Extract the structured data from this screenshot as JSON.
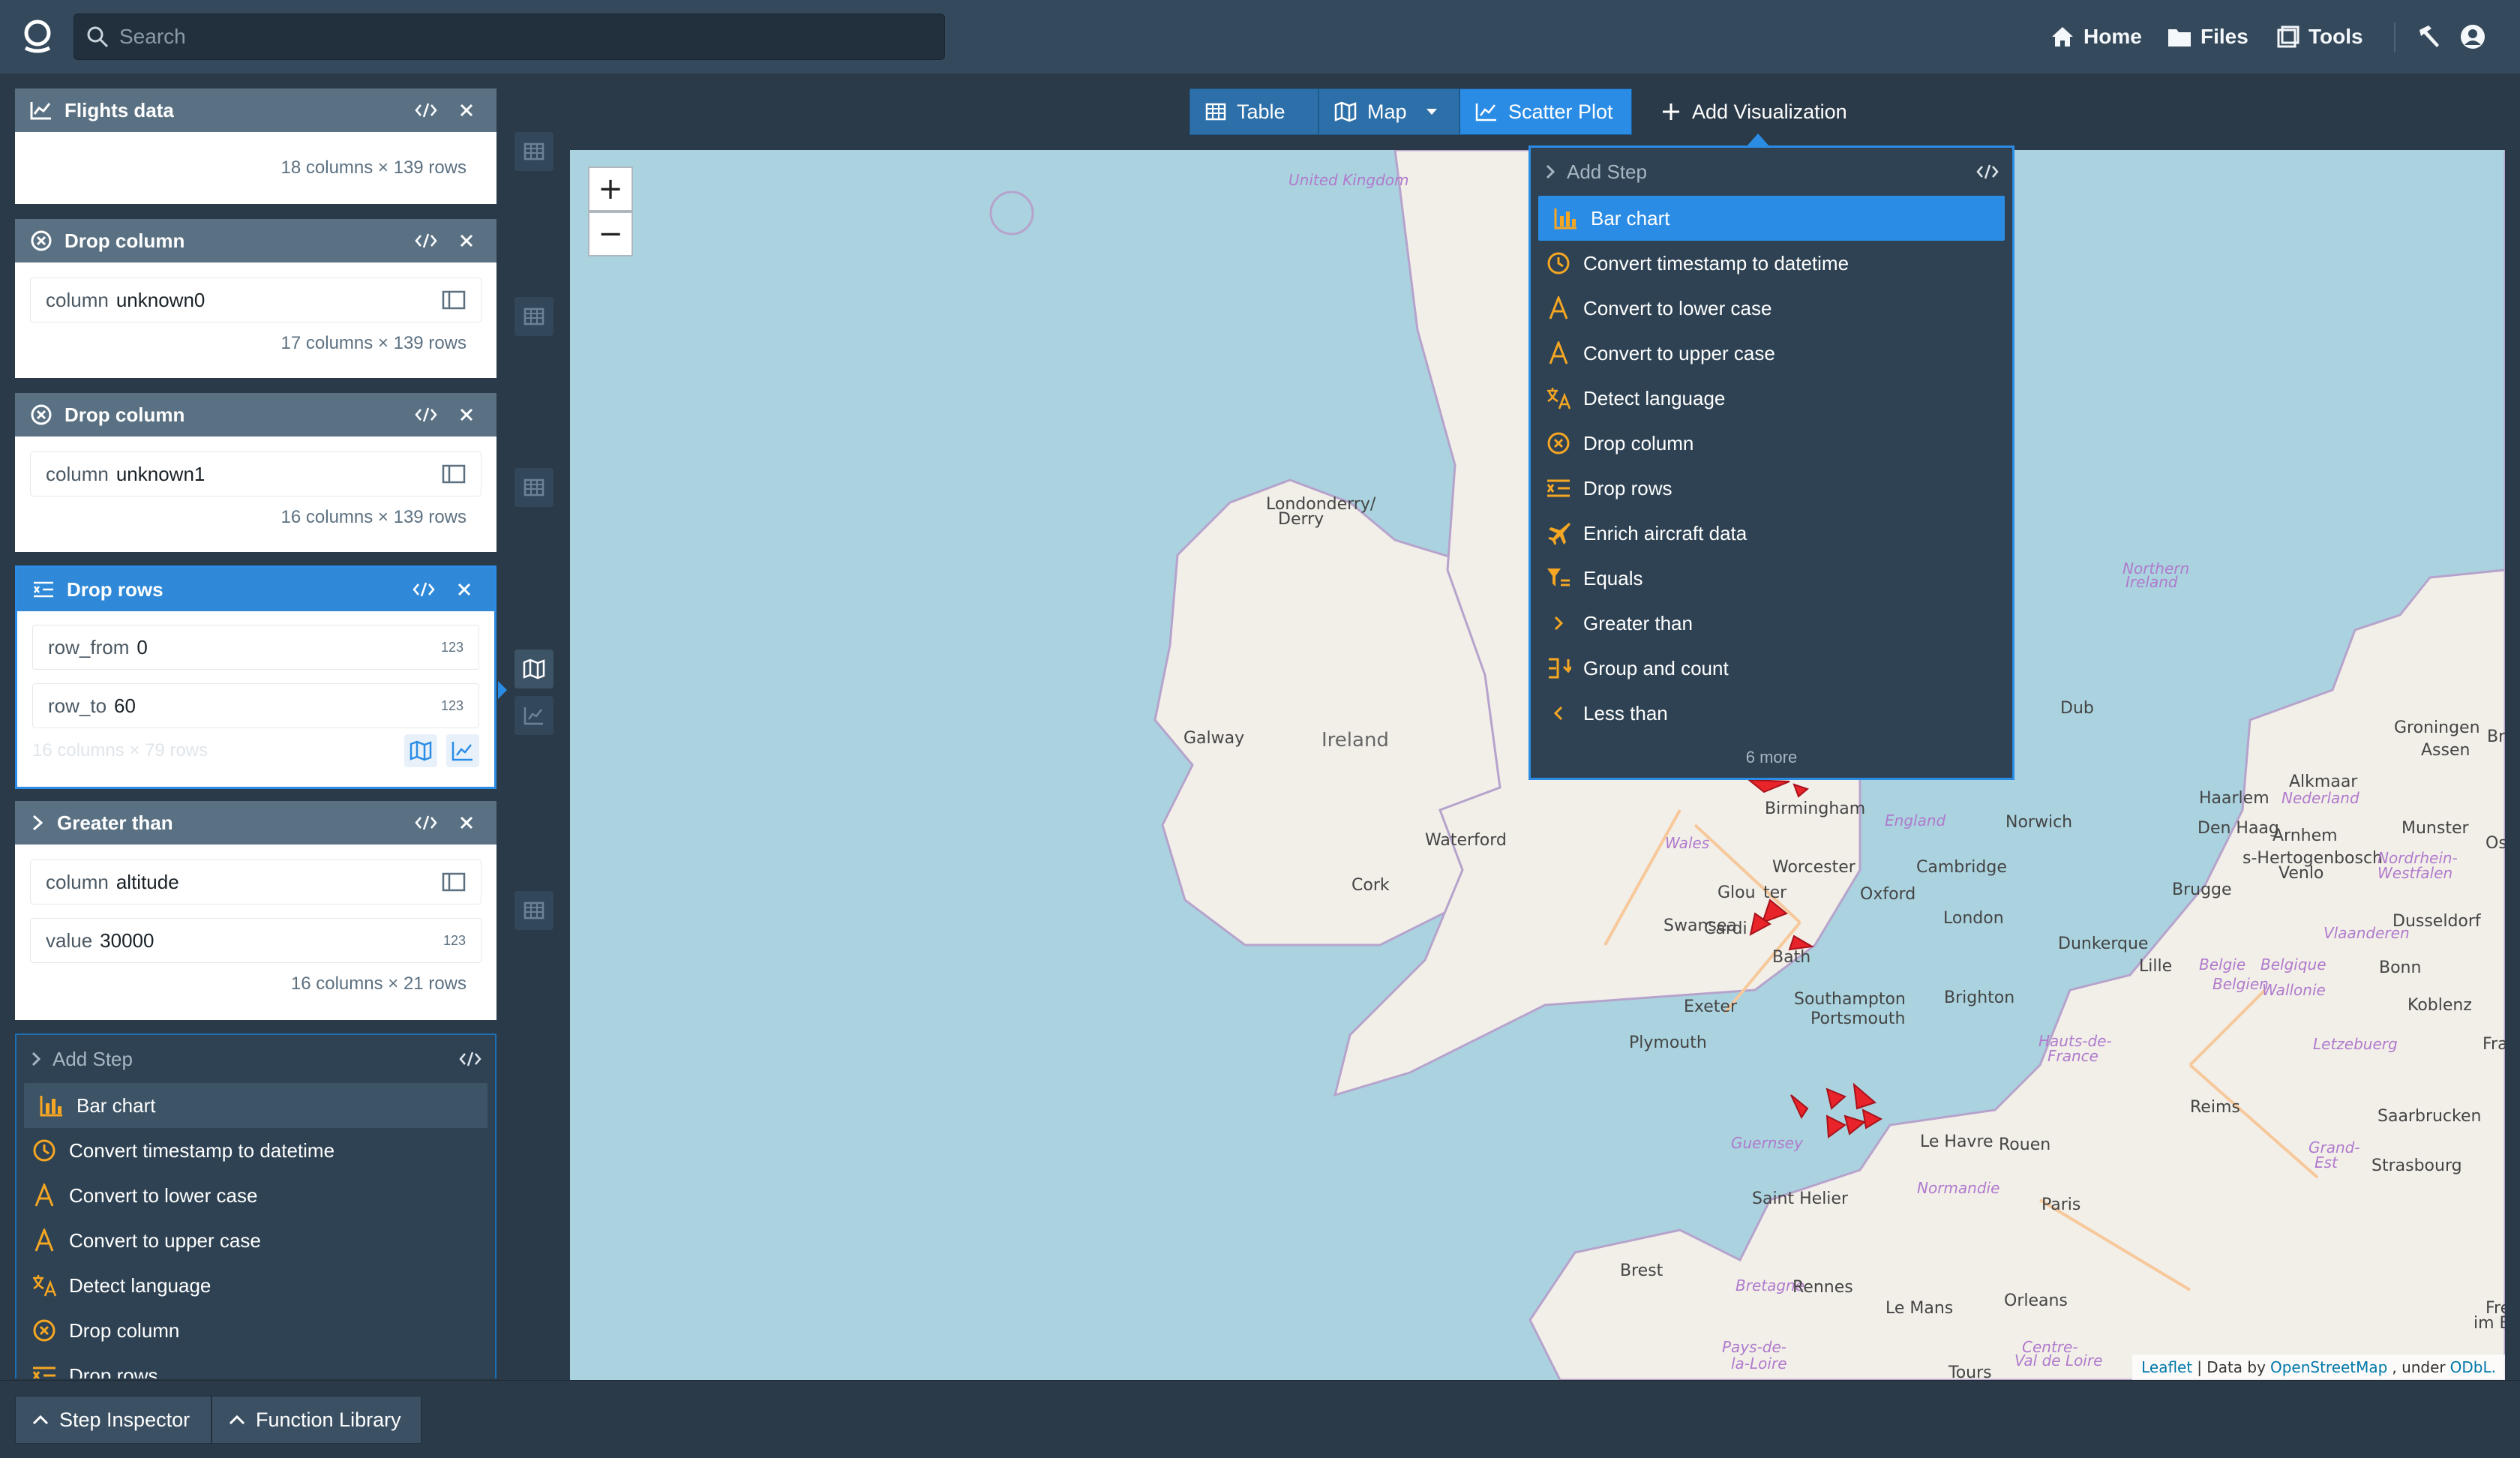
{
  "topbar": {
    "search_placeholder": "Search",
    "nav": [
      {
        "label": "Home",
        "icon": "home-icon"
      },
      {
        "label": "Files",
        "icon": "folder-icon"
      },
      {
        "label": "Tools",
        "icon": "tools-icon"
      }
    ]
  },
  "cards": {
    "flights": {
      "title": "Flights data",
      "rows_info": "18 columns × 139 rows"
    },
    "drop1": {
      "title": "Drop column",
      "param_name": "column",
      "param_value": "unknown0",
      "rows_info": "17 columns × 139 rows"
    },
    "drop2": {
      "title": "Drop column",
      "param_name": "column",
      "param_value": "unknown1",
      "rows_info": "16 columns × 139 rows"
    },
    "droprows": {
      "title": "Drop rows",
      "p1_name": "row_from",
      "p1_value": "0",
      "p1_badge": "123",
      "p2_name": "row_to",
      "p2_value": "60",
      "p2_badge": "123",
      "rows_info": "16 columns × 79 rows"
    },
    "greater": {
      "title": "Greater than",
      "p1_name": "column",
      "p1_value": "altitude",
      "p2_name": "value",
      "p2_value": "30000",
      "p2_badge": "123",
      "rows_info": "16 columns × 21 rows"
    }
  },
  "left_menu": {
    "header": "Add Step",
    "items": [
      {
        "label": "Bar chart",
        "icon": "bar-chart-icon",
        "selected": true
      },
      {
        "label": "Convert timestamp to datetime",
        "icon": "clock-icon"
      },
      {
        "label": "Convert to lower case",
        "icon": "font-a-icon"
      },
      {
        "label": "Convert to upper case",
        "icon": "font-a-icon"
      },
      {
        "label": "Detect language",
        "icon": "translate-icon"
      },
      {
        "label": "Drop column",
        "icon": "circle-x-icon"
      },
      {
        "label": "Drop rows",
        "icon": "drop-rows-icon"
      }
    ]
  },
  "viz_toolbar": {
    "table": "Table",
    "map": "Map",
    "scatter": "Scatter Plot",
    "add": "Add Visualization"
  },
  "viz_menu": {
    "header": "Add Step",
    "items": [
      {
        "label": "Bar chart",
        "icon": "bar-chart-icon",
        "selected": true
      },
      {
        "label": "Convert timestamp to datetime",
        "icon": "clock-icon"
      },
      {
        "label": "Convert to lower case",
        "icon": "font-a-icon"
      },
      {
        "label": "Convert to upper case",
        "icon": "font-a-icon"
      },
      {
        "label": "Detect language",
        "icon": "translate-icon"
      },
      {
        "label": "Drop column",
        "icon": "circle-x-icon"
      },
      {
        "label": "Drop rows",
        "icon": "drop-rows-icon"
      },
      {
        "label": "Enrich aircraft data",
        "icon": "airplane-icon"
      },
      {
        "label": "Equals",
        "icon": "filter-equals-icon"
      },
      {
        "label": "Greater than",
        "icon": "chevron-right-icon"
      },
      {
        "label": "Group and count",
        "icon": "group-count-icon"
      },
      {
        "label": "Less than",
        "icon": "chevron-left-icon"
      }
    ],
    "more": "6 more"
  },
  "map": {
    "zoom_in": "+",
    "zoom_out": "−",
    "labels": [
      {
        "text": "United Kingdom",
        "cls": "big"
      },
      {
        "text": "Londonderry/"
      },
      {
        "text": "Derry"
      },
      {
        "text": "Northern"
      },
      {
        "text": "Ireland"
      },
      {
        "text": "Dub"
      },
      {
        "text": "Galway"
      },
      {
        "text": "Ireland"
      },
      {
        "text": "Waterford"
      },
      {
        "text": "Cork"
      },
      {
        "text": "Birmingham"
      },
      {
        "text": "England"
      },
      {
        "text": "Norwich"
      },
      {
        "text": "Wales"
      },
      {
        "text": "Worcester"
      },
      {
        "text": "Cambridge"
      },
      {
        "text": "Glou"
      },
      {
        "text": "ter"
      },
      {
        "text": "Oxford"
      },
      {
        "text": "Swansea"
      },
      {
        "text": "Cardi"
      },
      {
        "text": "London"
      },
      {
        "text": "Bath"
      },
      {
        "text": "Exeter"
      },
      {
        "text": "Southampton"
      },
      {
        "text": "Brighton"
      },
      {
        "text": "Portsmouth"
      },
      {
        "text": "Plymouth"
      },
      {
        "text": "Guernsey"
      },
      {
        "text": "Le Havre"
      },
      {
        "text": "Rouen"
      },
      {
        "text": "Saint Helier"
      },
      {
        "text": "Normandie"
      },
      {
        "text": "Paris"
      },
      {
        "text": "Brest"
      },
      {
        "text": "Bretagne"
      },
      {
        "text": "Rennes"
      },
      {
        "text": "Le Mans"
      },
      {
        "text": "Orleans"
      },
      {
        "text": "Tours"
      },
      {
        "text": "Pays-de-"
      },
      {
        "text": "la-Loire"
      },
      {
        "text": "Centre-"
      },
      {
        "text": "Val de Loire"
      },
      {
        "text": "Groningen"
      },
      {
        "text": "Assen"
      },
      {
        "text": "Alkmaar"
      },
      {
        "text": "Haarlem"
      },
      {
        "text": "Nederland"
      },
      {
        "text": "Den Haag"
      },
      {
        "text": "Arnhem"
      },
      {
        "text": "Munster"
      },
      {
        "text": "Osnab"
      },
      {
        "text": "s-Hertogenbosch"
      },
      {
        "text": "Venlo"
      },
      {
        "text": "Nordrhein-"
      },
      {
        "text": "Westfalen"
      },
      {
        "text": "Brugge"
      },
      {
        "text": "Vlaanderen"
      },
      {
        "text": "Dusseldorf"
      },
      {
        "text": "Dunkerque"
      },
      {
        "text": "Lille"
      },
      {
        "text": "Belgie"
      },
      {
        "text": "Belgique"
      },
      {
        "text": "Belgien"
      },
      {
        "text": "Bonn"
      },
      {
        "text": "Wallonie"
      },
      {
        "text": "Koblenz"
      },
      {
        "text": "Hauts-de-"
      },
      {
        "text": "France"
      },
      {
        "text": "Letzebuerg"
      },
      {
        "text": "Reims"
      },
      {
        "text": "Saarbrucken"
      },
      {
        "text": "Grand-"
      },
      {
        "text": "Est"
      },
      {
        "text": "Strasbourg"
      },
      {
        "text": "Fra"
      },
      {
        "text": "Bre"
      },
      {
        "text": "Freibur"
      },
      {
        "text": "im Breisg"
      }
    ],
    "attribution": {
      "leaflet": "Leaflet",
      "sep": "| Data by",
      "osm": "OpenStreetMap",
      "under": ", under",
      "odbl": "ODbL."
    }
  },
  "bottombar": {
    "step_inspector": "Step Inspector",
    "function_library": "Function Library"
  },
  "colors": {
    "accent": "#2b8ce5",
    "menu_icon": "#f5a623",
    "marker": "#e8232a"
  }
}
